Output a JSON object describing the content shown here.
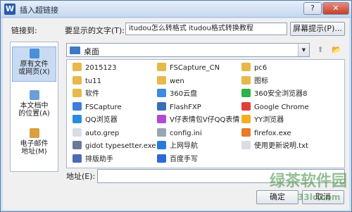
{
  "window": {
    "app_icon_letter": "W",
    "title": "插入超链接",
    "help_glyph": "?",
    "close_glyph": "✕"
  },
  "top": {
    "link_to_label": "链接到:",
    "display_text_label": "要显示的文字(T):",
    "display_text_value": "itudou怎么转格式  itudou格式转换教程",
    "screentip_button": "屏幕提示(P)..."
  },
  "linkbar": {
    "items": [
      {
        "label_lines": [
          "原有文件",
          "或网页(X)"
        ],
        "icon": "globe-file-icon",
        "color": "#4a8fd8",
        "selected": true
      },
      {
        "label_lines": [
          "本文档中",
          "的位置(A)"
        ],
        "icon": "document-place-icon",
        "color": "#6aa0d8",
        "selected": false
      },
      {
        "label_lines": [
          "电子邮件",
          "地址(M)"
        ],
        "icon": "email-icon",
        "color": "#d8a040",
        "selected": false
      }
    ]
  },
  "path": {
    "current": "桌面",
    "arrow_glyph": "▼",
    "up_glyph": "⬆",
    "browse_glyph": "📂"
  },
  "files": [
    {
      "name": "2015123",
      "icon": "folder-icon",
      "color": "#e8b84a"
    },
    {
      "name": "FSCapture_CN",
      "icon": "folder-icon",
      "color": "#e8b84a"
    },
    {
      "name": "pc6",
      "icon": "folder-icon",
      "color": "#e8b84a"
    },
    {
      "name": "tu11",
      "icon": "folder-icon",
      "color": "#e8b84a"
    },
    {
      "name": "wen",
      "icon": "folder-icon",
      "color": "#e8b84a"
    },
    {
      "name": "图标",
      "icon": "folder-icon",
      "color": "#e8b84a"
    },
    {
      "name": "软件",
      "icon": "folder-icon",
      "color": "#e8b84a"
    },
    {
      "name": "360云盘",
      "icon": "cloud-app-icon",
      "color": "#3b8be0"
    },
    {
      "name": "360安全浏览器8",
      "icon": "browser-360-icon",
      "color": "#2db24a"
    },
    {
      "name": "FSCapture",
      "icon": "capture-app-icon",
      "color": "#3f7dd8"
    },
    {
      "name": "FlashFXP",
      "icon": "ftp-app-icon",
      "color": "#3a6fb8"
    },
    {
      "name": "Google Chrome",
      "icon": "chrome-icon",
      "color": "#e0403a"
    },
    {
      "name": "QQ浏览器",
      "icon": "qq-browser-icon",
      "color": "#2a8ce0"
    },
    {
      "name": "V仔表情包V仔QQ表情...",
      "icon": "v-app-icon",
      "color": "#b04ad8"
    },
    {
      "name": "YY浏览器",
      "icon": "yy-browser-icon",
      "color": "#f0b020"
    },
    {
      "name": "auto.grep",
      "icon": "file-icon",
      "color": "#d8dde6"
    },
    {
      "name": "config.ini",
      "icon": "ini-file-icon",
      "color": "#9aa4b4"
    },
    {
      "name": "firefox.exe",
      "icon": "firefox-icon",
      "color": "#e87a2a"
    },
    {
      "name": "gidot typesetter.exe",
      "icon": "exe-icon",
      "color": "#6a7a98"
    },
    {
      "name": "上网导航",
      "icon": "ie-icon",
      "color": "#2a7ad8"
    },
    {
      "name": "使用更新说明.txt",
      "icon": "text-file-icon",
      "color": "#d8dde6"
    },
    {
      "name": "排版助手",
      "icon": "typeset-app-icon",
      "color": "#4a6ab8"
    },
    {
      "name": "百度手写",
      "icon": "baidu-pen-icon",
      "color": "#2a6ad8"
    }
  ],
  "address": {
    "label": "地址(E):",
    "value": ""
  },
  "buttons": {
    "ok": "确定",
    "cancel": "取消"
  },
  "watermark": {
    "main": "绿茶软件园",
    "sub": "33lc.com"
  }
}
